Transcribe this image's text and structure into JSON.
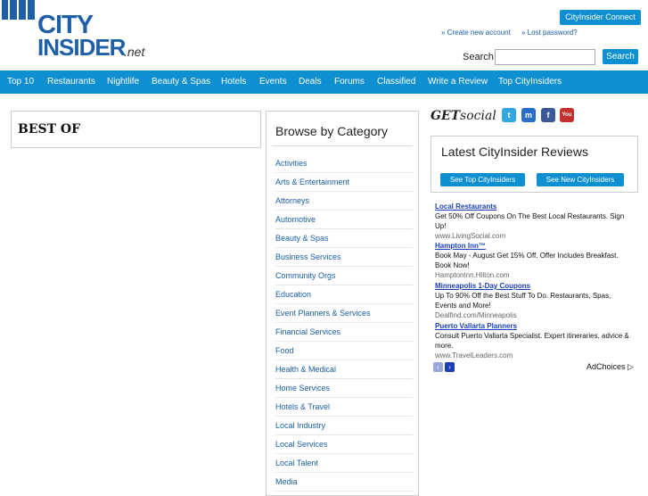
{
  "header": {
    "logo_word1": "CITY",
    "logo_word2": "INSIDER",
    "logo_suffix": ".net",
    "connect_label": "CityInsider Connect",
    "create_account": "» Create new account",
    "lost_password": "» Lost password?",
    "search_label": "Search",
    "search_value": "",
    "search_button": "Search"
  },
  "nav": [
    "Top 10",
    "Restaurants",
    "Nightlife",
    "Beauty & Spas",
    "Hotels",
    "Events",
    "Deals",
    "Forums",
    "Classified",
    "Write a Review",
    "Top CityInsiders"
  ],
  "best_of": {
    "title": "BEST OF"
  },
  "browse": {
    "title": "Browse by Category",
    "items": [
      "Activities",
      "Arts & Entertainment",
      "Attorneys",
      "Automotive",
      "Beauty & Spas",
      "Business Services",
      "Community Orgs",
      "Education",
      "Event Planners & Services",
      "Financial Services",
      "Food",
      "Health & Medical",
      "Home Services",
      "Hotels & Travel",
      "Local Industry",
      "Local Services",
      "Local Talent",
      "Media"
    ]
  },
  "social": {
    "get_prefix": "GET",
    "get_suffix": "social",
    "icons": [
      {
        "name": "twitter-icon",
        "glyph": "t",
        "color": "#33a8e0"
      },
      {
        "name": "myspace-icon",
        "glyph": "m",
        "color": "#2a6ec8"
      },
      {
        "name": "facebook-icon",
        "glyph": "f",
        "color": "#3b5998"
      },
      {
        "name": "youtube-icon",
        "glyph": "You",
        "color": "#c4302b"
      }
    ]
  },
  "reviews": {
    "title": "Latest CityInsider Reviews",
    "btn_top": "See Top CityInsiders",
    "btn_new": "See New CityInsiders"
  },
  "ads": {
    "items": [
      {
        "headline": "Local Restaurants",
        "desc": "Get 50% Off Coupons On The Best Local Restaurants. Sign Up!",
        "url": "www.LivingSocial.com"
      },
      {
        "headline": "Hampton Inn™",
        "desc": "Book May - August Get 15% Off. Offer Includes Breakfast. Book Now!",
        "url": "HamptonInn.Hilton.com"
      },
      {
        "headline": "Minneapolis 1-Day Coupons",
        "desc": "Up To 90% Off the Best Stuff To Do. Restaurants, Spas, Events and More!",
        "url": "Dealfind.com/Minneapolis"
      },
      {
        "headline": "Puerto Vallarta Planners",
        "desc": "Consult Puerto Vallarta Specialist. Expert itineraries, advice & more.",
        "url": "www.TravelLeaders.com"
      }
    ],
    "prev_glyph": "‹",
    "next_glyph": "›",
    "adchoices": "AdChoices ▷"
  },
  "colors": {
    "accent": "#0e8fd1",
    "logo": "#1f5fa8",
    "link": "#1a5fa8"
  }
}
